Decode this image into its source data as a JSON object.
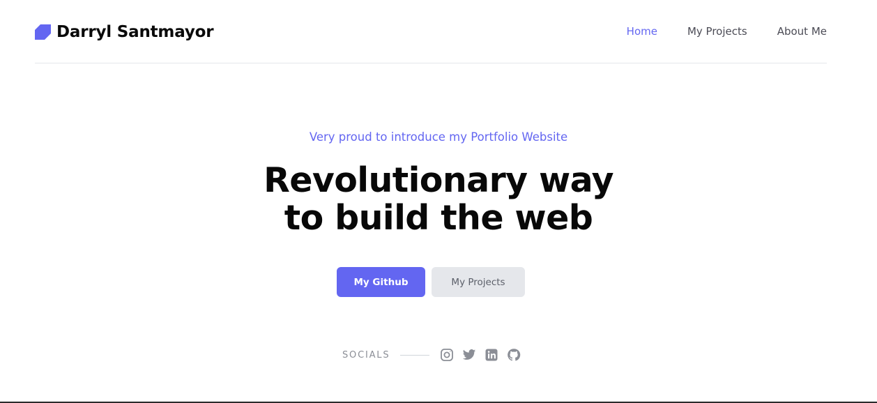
{
  "header": {
    "brand_name": "Darryl Santmayor",
    "brand_icon": "tag-logo-icon",
    "nav": [
      {
        "label": "Home",
        "active": true
      },
      {
        "label": "My Projects",
        "active": false
      },
      {
        "label": "About Me",
        "active": false
      }
    ]
  },
  "hero": {
    "kicker": "Very proud to introduce my Portfolio Website",
    "headline_line1": "Revolutionary way",
    "headline_line2": "to build the web",
    "primary_button": "My Github",
    "secondary_button": "My Projects"
  },
  "socials": {
    "label": "SOCIALS",
    "icons": [
      "instagram-icon",
      "twitter-icon",
      "linkedin-icon",
      "github-icon"
    ]
  },
  "colors": {
    "accent": "#6366f1",
    "secondary_button_bg": "#e5e7eb",
    "muted_text": "#8b8e96",
    "divider": "#e5e7eb"
  }
}
